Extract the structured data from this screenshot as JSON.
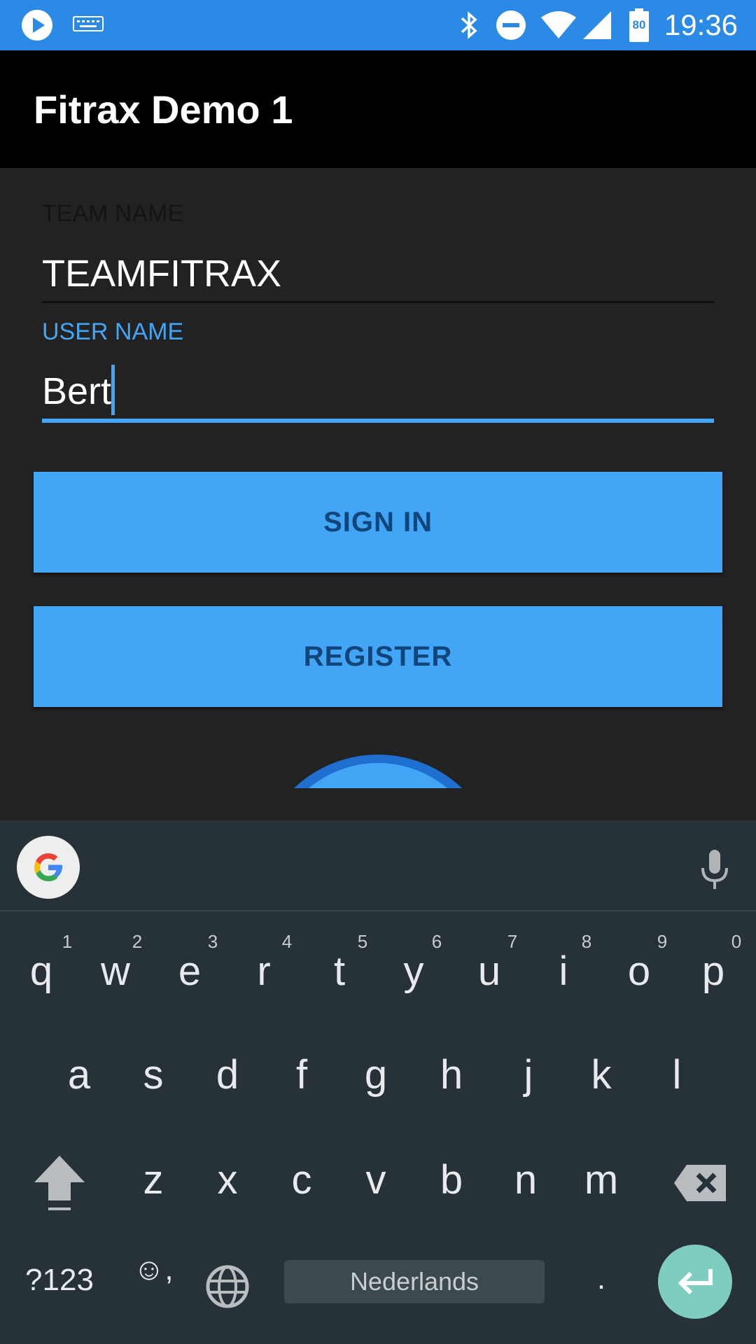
{
  "status_bar": {
    "time": "19:36",
    "battery_level": "80",
    "icons": [
      "play-icon",
      "keyboard-icon",
      "bluetooth-icon",
      "dnd-icon",
      "wifi-icon",
      "signal-icon",
      "battery-icon"
    ],
    "color": "#2a8ae6"
  },
  "app_bar": {
    "title": "Fitrax Demo 1"
  },
  "form": {
    "team_label": "TEAM NAME",
    "team_value": "TEAMFITRAX",
    "user_label": "USER NAME",
    "user_value": "Bert",
    "accent_color": "#42a5f5"
  },
  "buttons": {
    "sign_in": "SIGN IN",
    "register": "REGISTER"
  },
  "keyboard": {
    "language": "Nederlands",
    "symbols_key": "?123",
    "emoji_key": "☺,",
    "period_key": ".",
    "row1": [
      "q",
      "w",
      "e",
      "r",
      "t",
      "y",
      "u",
      "i",
      "o",
      "p"
    ],
    "row1_hints": [
      "1",
      "2",
      "3",
      "4",
      "5",
      "6",
      "7",
      "8",
      "9",
      "0"
    ],
    "row2": [
      "a",
      "s",
      "d",
      "f",
      "g",
      "h",
      "j",
      "k",
      "l"
    ],
    "row3": [
      "z",
      "x",
      "c",
      "v",
      "b",
      "n",
      "m"
    ],
    "enter_color": "#7fcdbf"
  }
}
